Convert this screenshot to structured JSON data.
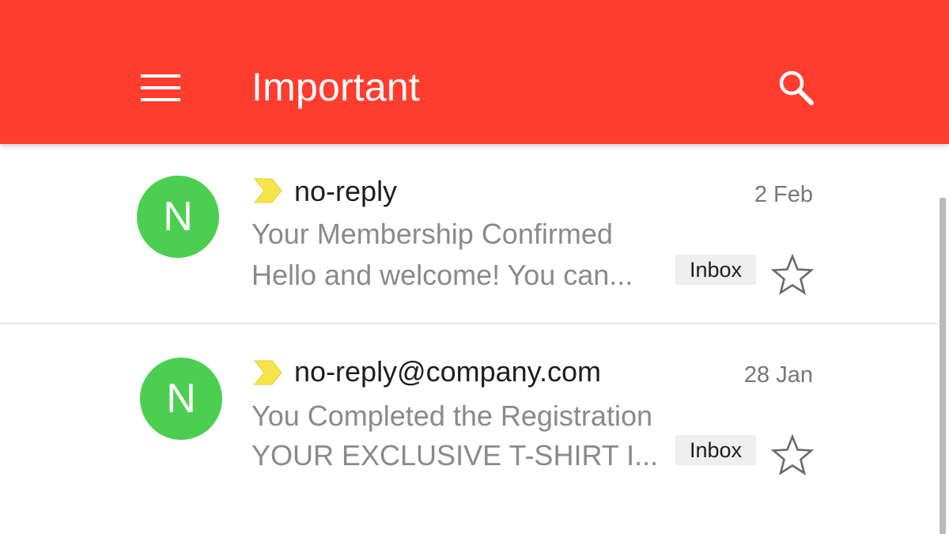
{
  "appbar": {
    "title": "Important",
    "menu_icon": "hamburger-menu-icon",
    "search_icon": "search-icon",
    "color": "#ff3d2e"
  },
  "emails": [
    {
      "avatar_letter": "N",
      "avatar_color": "#4ccf50",
      "importance_icon": "importance-marker-icon",
      "sender": "no-reply",
      "date": "2 Feb",
      "subject": "Your Membership Confirmed",
      "snippet": "Hello and welcome! You can...",
      "label": "Inbox",
      "star_icon": "star-outline-icon",
      "starred": false
    },
    {
      "avatar_letter": "N",
      "avatar_color": "#4ccf50",
      "importance_icon": "importance-marker-icon",
      "sender": "no-reply@company.com",
      "date": "28 Jan",
      "subject": "You Completed the Registration",
      "snippet": "YOUR EXCLUSIVE T-SHIRT I...",
      "label": "Inbox",
      "star_icon": "star-outline-icon",
      "starred": false
    }
  ],
  "colors": {
    "importance_marker": "#f5e54a",
    "avatar": "#4ccf50",
    "label_chip_bg": "#efefef"
  }
}
